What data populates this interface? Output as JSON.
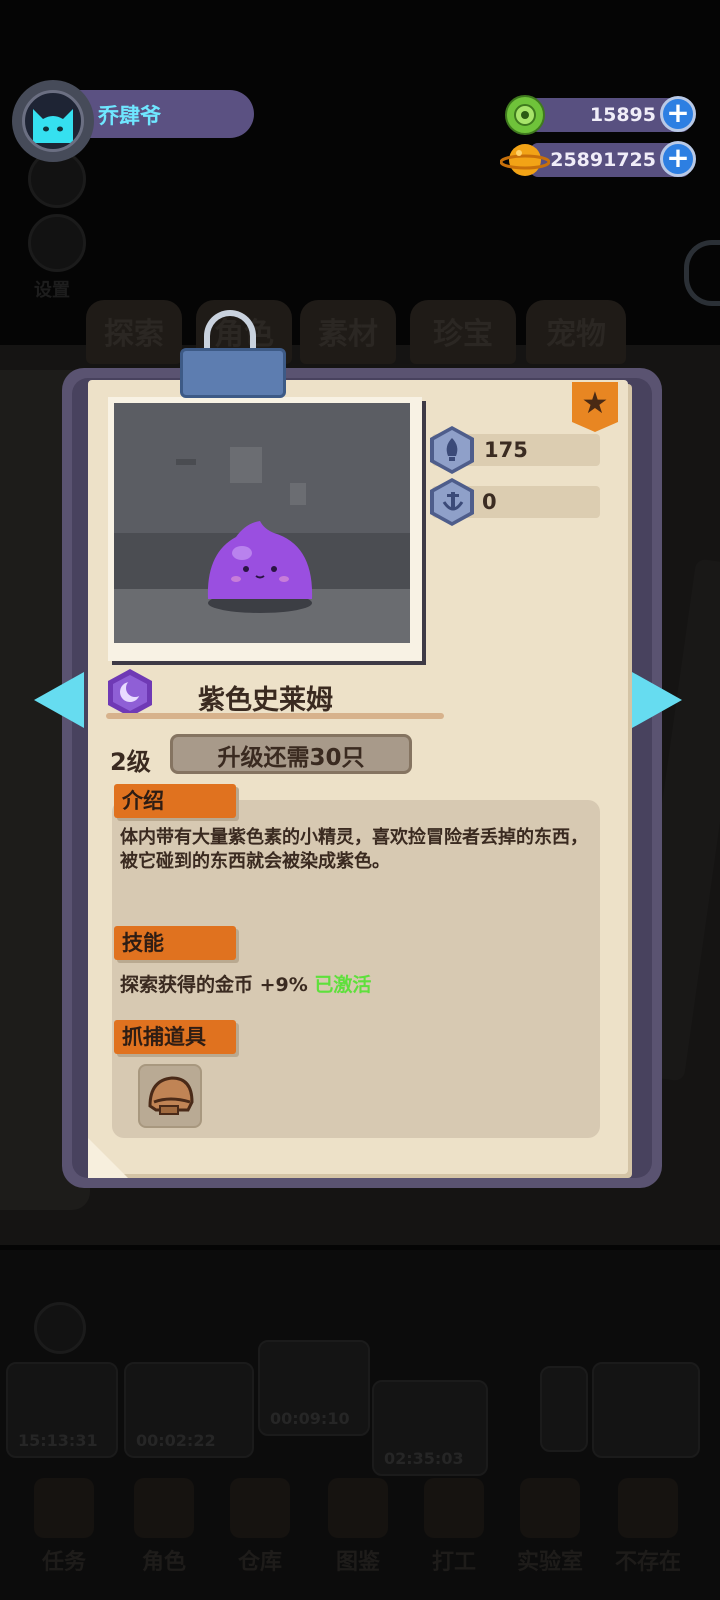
{
  "player": {
    "name": "乔肆爷"
  },
  "currency": [
    {
      "name": "donut-coin",
      "value": "15895",
      "color": "#6fc33a"
    },
    {
      "name": "planet-coin",
      "value": "25891725",
      "color": "#f2a316"
    }
  ],
  "background": {
    "side_label": "设置",
    "tabs": [
      "探索",
      "角色",
      "素材",
      "珍宝",
      "宠物"
    ],
    "slot_times": [
      "15:13:31",
      "00:02:22",
      "00:09:10",
      "02:35:03"
    ],
    "nav": [
      "任务",
      "角色",
      "仓库",
      "图鉴",
      "打工",
      "实验室",
      "不存在"
    ]
  },
  "pet": {
    "name": "紫色史莱姆",
    "stat_attack": "175",
    "stat_defense": "0",
    "level": "2级",
    "upgrade_text": "升级还需30只",
    "intro_title": "介绍",
    "intro_text": "体内带有大量紫色素的小精灵，喜欢捡冒险者丢掉的东西，被它碰到的东西就会被染成紫色。",
    "skill_title": "技能",
    "skill_text": "探索获得的金币 +9%",
    "skill_status": "已激活",
    "tool_title": "抓捕道具",
    "rarity_icon": "star-icon",
    "element_icon": "moon-icon",
    "tool_icon": "helmet-icon"
  },
  "colors": {
    "accent": "#66dcf0",
    "tag": "#e0721f",
    "active": "#5ee03c",
    "frame": "#5a5371"
  }
}
